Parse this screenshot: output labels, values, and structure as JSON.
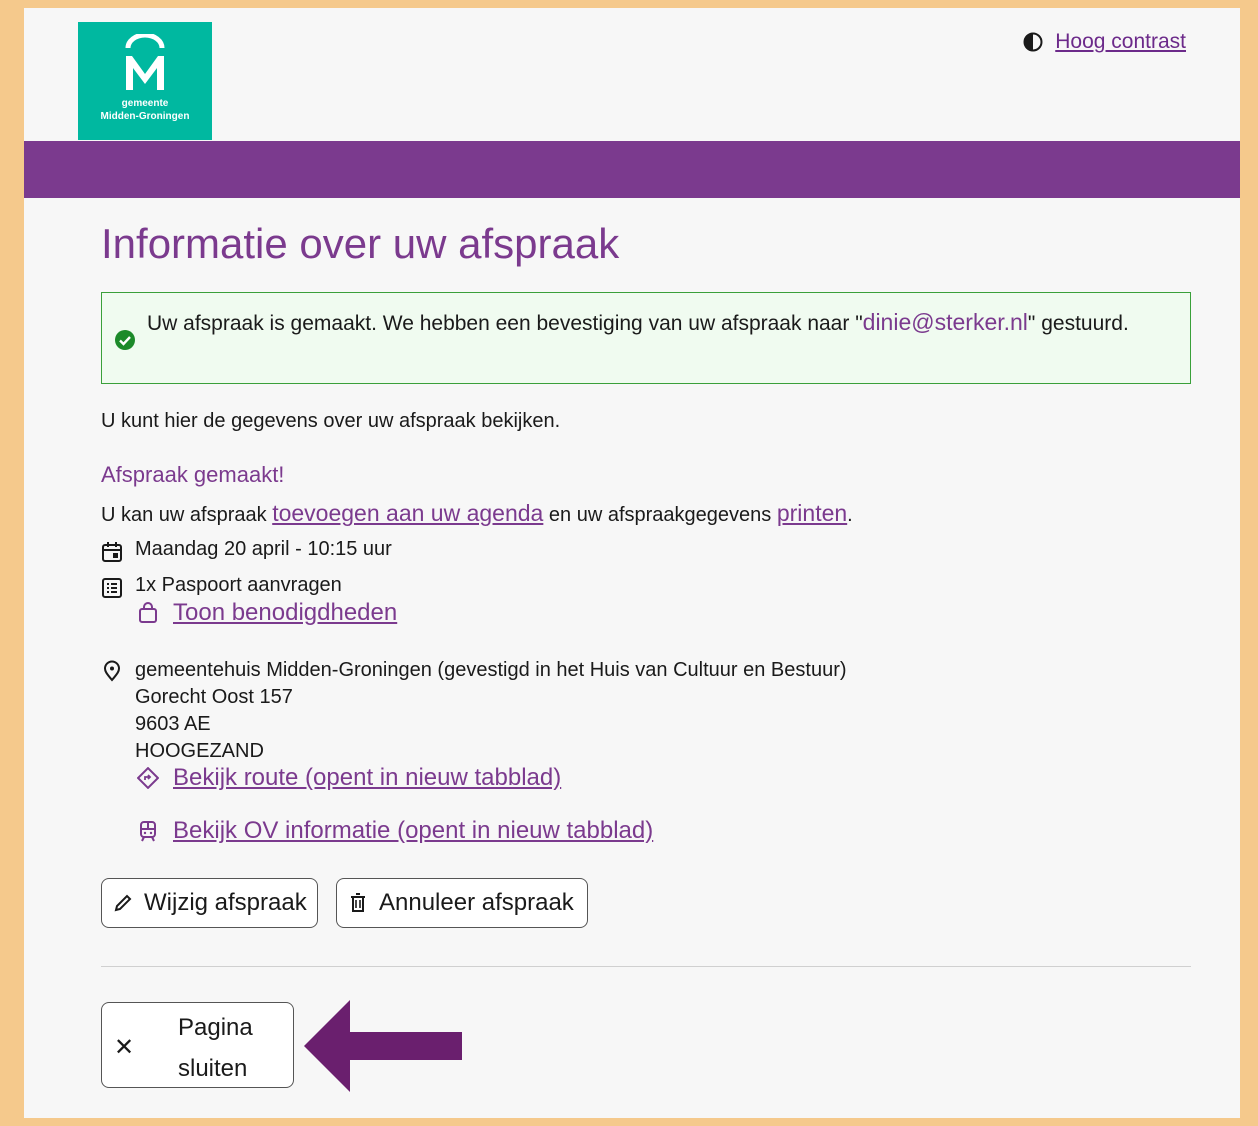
{
  "header": {
    "logo_line1": "gemeente",
    "logo_line2": "Midden-Groningen",
    "contrast_label": "Hoog contrast"
  },
  "page": {
    "title": "Informatie over uw afspraak",
    "alert": {
      "text_before": "Uw afspraak is gemaakt. We hebben een bevestiging van uw afspraak naar ",
      "quote_open": "\"",
      "email": "dinie@sterker.nl",
      "quote_close": "\"",
      "text_after": " gestuurd."
    },
    "intro": "U kunt hier de gegevens over uw afspraak bekijken.",
    "subhead": "Afspraak gemaakt!",
    "links_line": {
      "prefix": "U kan uw afspraak ",
      "agenda_link": "toevoegen aan uw agenda",
      "middle": " en uw afspraakgegevens ",
      "print_link": "printen",
      "suffix": "."
    },
    "datetime": "Maandag 20 april - 10:15 uur",
    "product": "1x Paspoort aanvragen",
    "requirements_link": "Toon benodigdheden",
    "location": {
      "name": "gemeentehuis Midden-Groningen (gevestigd in het Huis van Cultuur en Bestuur)",
      "street": "Gorecht Oost 157",
      "postcode": "9603 AE",
      "city": "HOOGEZAND"
    },
    "route_link": "Bekijk route (opent in nieuw tabblad)",
    "ov_link": "Bekijk OV informatie (opent in nieuw tabblad)",
    "edit_button": "Wijzig afspraak",
    "cancel_button": "Annuleer afspraak",
    "close_button": "Pagina sluiten"
  },
  "colors": {
    "brand_purple": "#7b3a8e",
    "logo_teal": "#00b8a0",
    "success_green": "#1c8a2a",
    "frame_orange": "#f5c98c",
    "arrow_purple": "#6a1f6e"
  }
}
